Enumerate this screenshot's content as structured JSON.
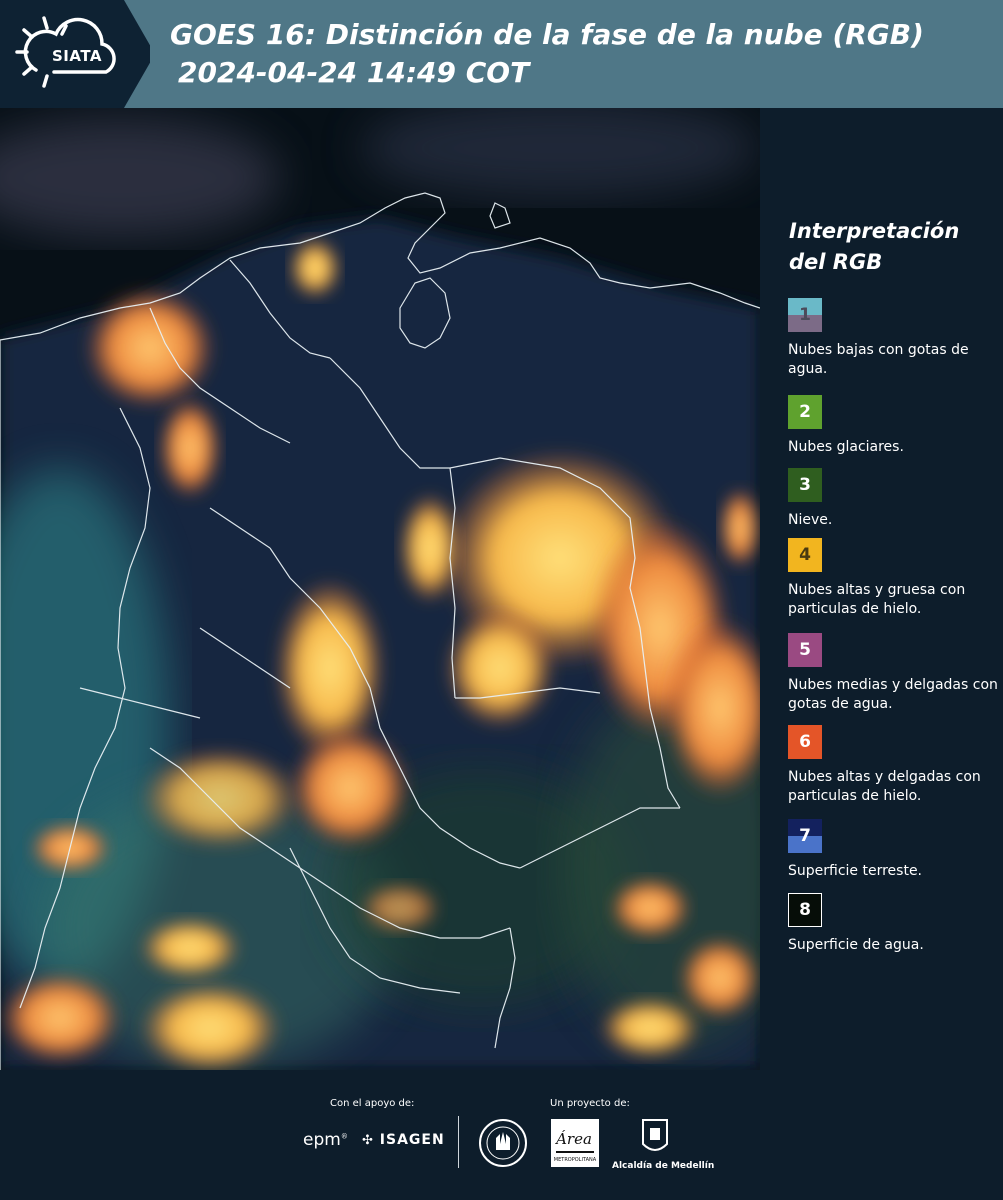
{
  "header": {
    "logo": "SIATA",
    "title": "GOES 16: Distinción de la fase de la nube (RGB)",
    "subtitle": "2024-04-24 14:49 COT"
  },
  "legend": {
    "title": "Interpretación del RGB",
    "items": [
      {
        "num": "1",
        "label": "Nubes bajas con gotas de agua.",
        "color_top": "#6ab9c8",
        "color_bottom": "#7c6b87",
        "num_color": "#4b4b5a"
      },
      {
        "num": "2",
        "label": "Nubes glaciares.",
        "color": "#5fa22e",
        "num_color": "#ffffff"
      },
      {
        "num": "3",
        "label": "Nieve.",
        "color": "#2f5e1f",
        "num_color": "#ffffff"
      },
      {
        "num": "4",
        "label": "Nubes altas y gruesa con particulas de hielo.",
        "color": "#f2b51f",
        "num_color": "#4a3a10"
      },
      {
        "num": "5",
        "label": "Nubes medias y delgadas con gotas de agua.",
        "color": "#9a4a82",
        "num_color": "#ffffff"
      },
      {
        "num": "6",
        "label": "Nubes altas y delgadas con particulas de hielo.",
        "color": "#e45528",
        "num_color": "#ffffff"
      },
      {
        "num": "7",
        "label": "Superficie terreste.",
        "color_top": "#13215e",
        "color_bottom": "#4a73c9",
        "num_color": "#ffffff"
      },
      {
        "num": "8",
        "label": "Superficie de agua.",
        "color": "#060d08",
        "num_color": "#ffffff",
        "border": "#ffffff"
      }
    ]
  },
  "footer": {
    "support_label": "Con el apoyo de:",
    "project_label": "Un proyecto de:",
    "sponsor_epm": "epm",
    "sponsor_isagen": "ISAGEN",
    "logo_amva": "Área Metropolitana Valle de Aburrá",
    "logo_alcaldia": "Alcaldía de Medellín"
  }
}
